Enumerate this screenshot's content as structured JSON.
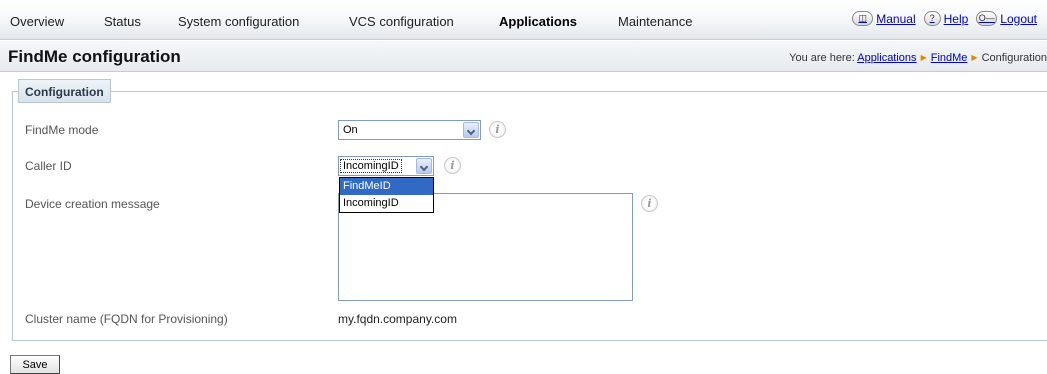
{
  "nav": {
    "items": [
      "Overview",
      "Status",
      "System configuration",
      "VCS configuration",
      "Applications",
      "Maintenance"
    ],
    "active": "Applications",
    "links": [
      {
        "label": "Manual",
        "icon": "book-icon"
      },
      {
        "label": "Help",
        "icon": "help-icon"
      },
      {
        "label": "Logout",
        "icon": "key-icon"
      }
    ],
    "icon_glyphs": {
      "manual": "🕮",
      "help": "?",
      "logout": "O—"
    }
  },
  "page": {
    "title": "FindMe configuration",
    "breadcrumb_prefix": "You are here:",
    "breadcrumb": [
      "Applications",
      "FindMe",
      "Configuration"
    ]
  },
  "form": {
    "legend": "Configuration",
    "findme_mode": {
      "label": "FindMe mode",
      "value": "On"
    },
    "caller_id": {
      "label": "Caller ID",
      "value": "IncomingID",
      "options": [
        "FindMeID",
        "IncomingID"
      ],
      "highlighted": "FindMeID"
    },
    "device_creation_message": {
      "label": "Device creation message",
      "value": ""
    },
    "cluster_name": {
      "label": "Cluster name (FQDN for Provisioning)",
      "value": "my.fqdn.company.com"
    },
    "info_glyph": "i"
  },
  "actions": {
    "save_label": "Save"
  },
  "colors": {
    "link": "#0000cc",
    "highlight": "#316ac5",
    "border": "#b9c7d3"
  }
}
